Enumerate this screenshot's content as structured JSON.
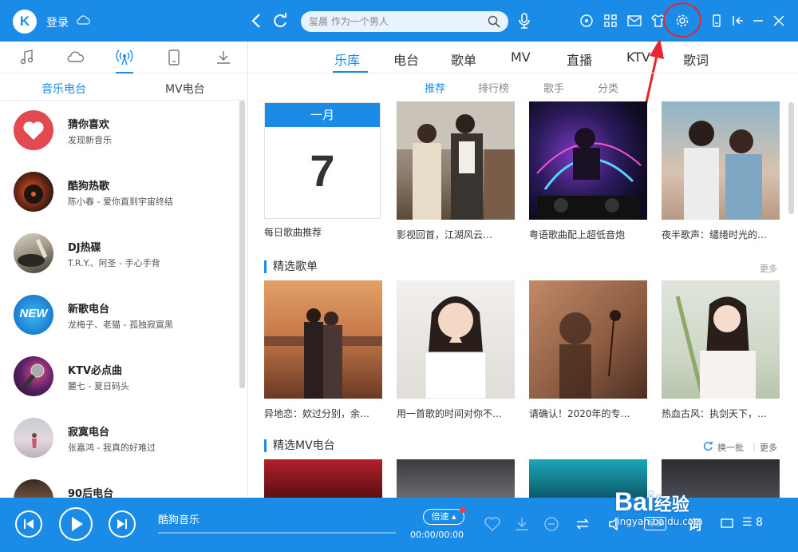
{
  "titlebar": {
    "logo": "K",
    "login": "登录",
    "search_placeholder": "玺晨 作为一个男人",
    "icons": [
      "radio-icon",
      "apps-icon",
      "mail-icon",
      "skin-icon",
      "settings-icon",
      "mini-mode-icon",
      "exit-icon",
      "minimize-icon",
      "close-icon"
    ]
  },
  "left": {
    "icon_tabs": [
      "music-note-icon",
      "cloud-icon",
      "radio-broadcast-icon",
      "device-icon",
      "download-icon"
    ],
    "sub_tabs": {
      "music_radio": "音乐电台",
      "mv_radio": "MV电台"
    },
    "items": [
      {
        "title": "猜你喜欢",
        "sub": "发现新音乐"
      },
      {
        "title": "酷狗热歌",
        "sub": "陈小春 - 爱你直到宇宙终结"
      },
      {
        "title": "DJ热碟",
        "sub": "T.R.Y.、阿圣 - 手心手背"
      },
      {
        "title": "新歌电台",
        "sub": "龙梅子、老猫 - 孤独寂寞黑"
      },
      {
        "title": "KTV必点曲",
        "sub": "麓七 - 夏日码头"
      },
      {
        "title": "寂寞电台",
        "sub": "张嘉鸿 - 我真的好难过"
      },
      {
        "title": "90后电台",
        "sub": ""
      }
    ],
    "new_badge": "NEW"
  },
  "main": {
    "tabs": [
      "乐库",
      "电台",
      "歌单",
      "MV",
      "直播",
      "KTV",
      "歌词"
    ],
    "sub_tabs": [
      "推荐",
      "排行榜",
      "歌手",
      "分类"
    ],
    "calendar": {
      "month": "一月",
      "day": "7"
    },
    "row1_captions": [
      "每日歌曲推荐",
      "影视回首，江湖风云…",
      "粤语歌曲配上超低音炮",
      "夜半歌声：缱绻时光的…"
    ],
    "section_playlists": {
      "title": "精选歌单",
      "more": "更多"
    },
    "row2_captions": [
      "异地恋：欸过分别，余…",
      "用一首歌的时间对你不…",
      "请确认！2020年的专…",
      "热血古风：执剑天下，…"
    ],
    "section_mv": {
      "title": "精选MV电台",
      "refresh": "换一批",
      "more": "更多"
    }
  },
  "player": {
    "track": "酷狗音乐",
    "speed": "倍速",
    "time": "00:00/00:00",
    "hq": "标准",
    "lyric": "词",
    "list_count": "8"
  },
  "watermark": {
    "brand": "Bai",
    "brand2": "经验",
    "url": "jingyan.baidu.com"
  },
  "colors": {
    "brand": "#1a8ce8",
    "highlight": "#e8262f"
  }
}
